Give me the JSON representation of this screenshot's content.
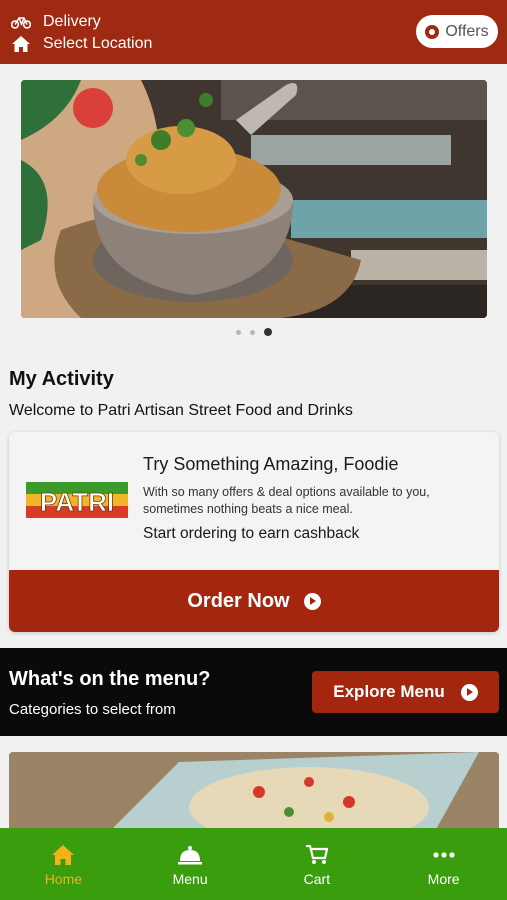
{
  "header": {
    "mode_label": "Delivery",
    "location_label": "Select Location",
    "offers_label": "Offers",
    "mode_icon": "bicycle-icon",
    "location_icon": "home-icon"
  },
  "carousel": {
    "slide_count": 3,
    "active_index": 2
  },
  "activity": {
    "title": "My Activity",
    "welcome": "Welcome to Patri Artisan Street Food and Drinks"
  },
  "promo": {
    "logo_text": "PATRI",
    "headline": "Try Something Amazing, Foodie",
    "body": "With so many offers & deal options available to you, sometimes nothing beats a nice meal.",
    "cta_text": "Start ordering to earn cashback",
    "order_button": "Order Now"
  },
  "menu_section": {
    "title": "What's on the menu?",
    "subtitle": "Categories to select from",
    "explore_button": "Explore Menu"
  },
  "tabbar": {
    "items": [
      {
        "label": "Home",
        "icon": "home-icon",
        "active": true
      },
      {
        "label": "Menu",
        "icon": "cloche-icon",
        "active": false
      },
      {
        "label": "Cart",
        "icon": "cart-icon",
        "active": false
      },
      {
        "label": "More",
        "icon": "more-icon",
        "active": false
      }
    ]
  },
  "colors": {
    "header_bg": "#9e2a12",
    "button_red": "#a4260f",
    "tabbar_green": "#3a9d0e",
    "tab_active": "#f2b318"
  }
}
